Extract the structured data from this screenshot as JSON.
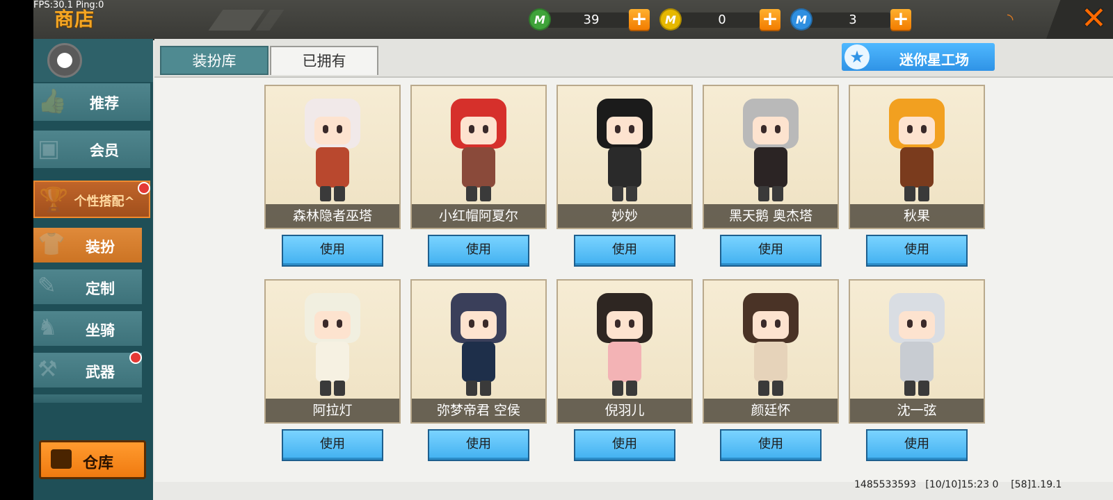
{
  "overlay": {
    "fps": "FPS:30.1  Ping:0"
  },
  "header": {
    "title": "商店",
    "currencies": [
      {
        "icon": "green-gem-icon",
        "icon_glyph": "M",
        "color": "#3fa33a",
        "value": "39"
      },
      {
        "icon": "gold-coin-icon",
        "icon_glyph": "M",
        "color": "#e6b800",
        "value": "0"
      },
      {
        "icon": "blue-coin-icon",
        "icon_glyph": "M",
        "color": "#2f8fe0",
        "value": "3"
      }
    ],
    "plus_label": "+",
    "close_label": "✕",
    "signal_icon": "signal-icon"
  },
  "sidebar": {
    "items": [
      {
        "label": "推荐",
        "icon": "thumbs-up-icon"
      },
      {
        "label": "会员",
        "icon": "member-icon"
      },
      {
        "label": "个性搭配^",
        "icon": "trophy-icon"
      },
      {
        "label": "装扮",
        "icon": "shirt-icon"
      },
      {
        "label": "定制",
        "icon": "pencil-icon"
      },
      {
        "label": "坐骑",
        "icon": "mount-icon"
      },
      {
        "label": "武器",
        "icon": "gun-icon"
      }
    ],
    "warehouse_label": "仓库"
  },
  "tabs": {
    "wardrobe": "装扮库",
    "owned": "已拥有"
  },
  "workshop_label": "迷你星工场",
  "use_label": "使用",
  "skins": [
    {
      "name": "森林隐者巫塔",
      "hair": "#f1e9e9",
      "outfit": "#b9482e"
    },
    {
      "name": "小红帽阿夏尔",
      "hair": "#d6302b",
      "outfit": "#8a4a3a"
    },
    {
      "name": "妙妙",
      "hair": "#1b1b1b",
      "outfit": "#2a2a2a"
    },
    {
      "name": "黑天鹅 奥杰塔",
      "hair": "#b9b9b9",
      "outfit": "#2b2424"
    },
    {
      "name": "秋果",
      "hair": "#f2a020",
      "outfit": "#7a3b1d"
    },
    {
      "name": "阿拉灯",
      "hair": "#f1efe0",
      "outfit": "#f6f1e2"
    },
    {
      "name": "弥梦帝君 空侯",
      "hair": "#3a3f5a",
      "outfit": "#1e2f4a"
    },
    {
      "name": "倪羽儿",
      "hair": "#2e2622",
      "outfit": "#f3b3b5"
    },
    {
      "name": "颜廷怀",
      "hair": "#4a3326",
      "outfit": "#e6d3ba"
    },
    {
      "name": "沈一弦",
      "hair": "#d9dde3",
      "outfit": "#c8ccd2"
    }
  ],
  "footer": {
    "info": "1485533593   [10/10]15:23 0    [58]1.19.1"
  }
}
